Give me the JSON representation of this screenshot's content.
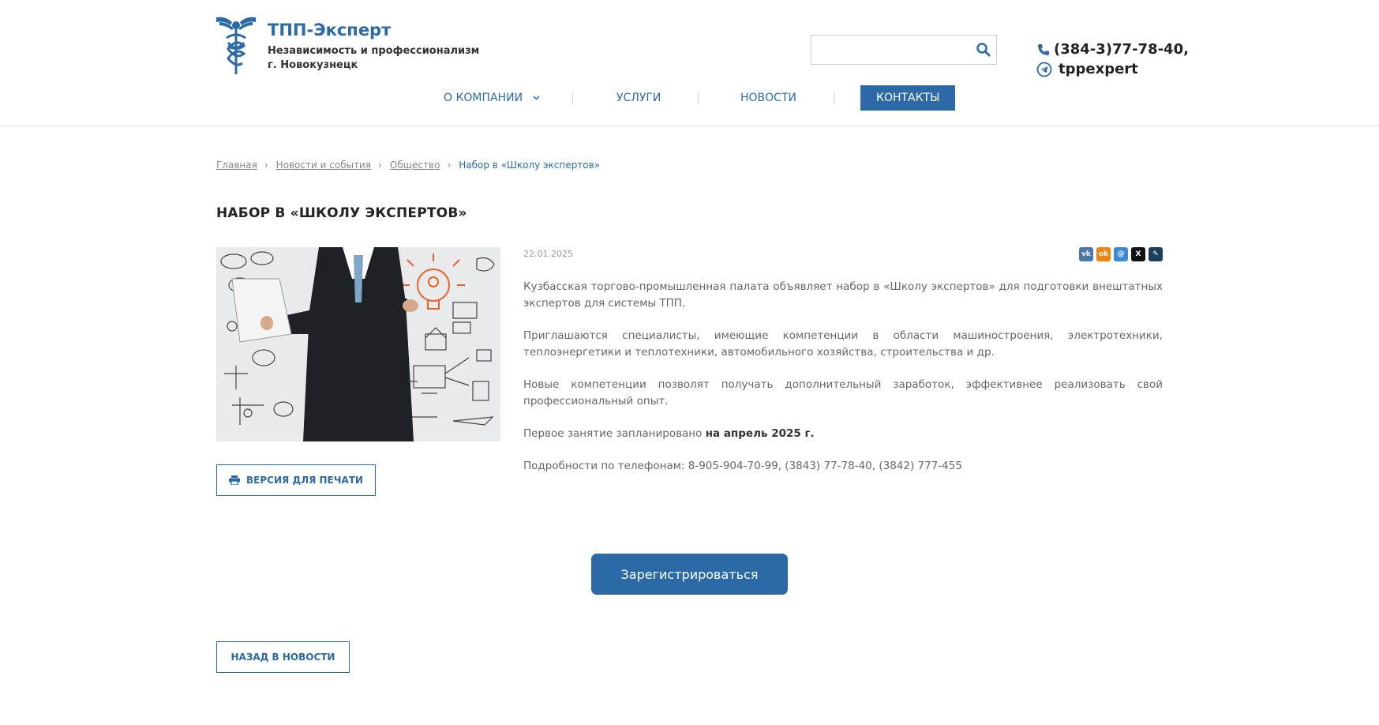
{
  "header": {
    "brand_title": "ТПП-Эксперт",
    "brand_sub_1": "Независимость и профессионализм",
    "brand_sub_2": "г. Новокузнецк",
    "search": {
      "placeholder": "",
      "value": ""
    },
    "phone": "(384-3)77-78-40,",
    "telegram": "tppexpert"
  },
  "nav": {
    "items": [
      {
        "label": "О компании",
        "has_dropdown": true
      },
      {
        "label": "Услуги"
      },
      {
        "label": "Новости"
      },
      {
        "label": "Контакты",
        "active": true
      }
    ]
  },
  "breadcrumb": {
    "items": [
      "Главная",
      "Новости и события",
      "Общество"
    ],
    "current": "Набор в «Школу экспертов»"
  },
  "page": {
    "title": "НАБОР В «ШКОЛУ ЭКСПЕРТОВ»",
    "date": "22.01.2025",
    "paragraphs": [
      "Кузбасская торгово-промышленная палата объявляет набор в «Школу экспертов» для подготовки внештатных экспертов для системы ТПП.",
      "Приглашаются специалисты, имеющие компетенции в области машиностроения, электротехники, теплоэнергетики и теплотехники, автомобильного хозяйства, строительства и др.",
      "Новые компетенции позволят получать дополнительный заработок, эффективнее реализовать свой профессиональный опыт."
    ],
    "p4_prefix": "Первое занятие запланировано ",
    "p4_bold": "на апрель 2025 г.",
    "p5": "Подробности по телефонам: 8-905-904-70-99, (3843) 77-78-40, (3842) 777-455"
  },
  "buttons": {
    "print": "ВЕРСИЯ ДЛЯ ПЕЧАТИ",
    "register": "Зарегистрироваться",
    "back": "НАЗАД В НОВОСТИ"
  },
  "share": {
    "icons": [
      "vk-icon",
      "odnoklassniki-icon",
      "moimir-icon",
      "x-icon",
      "livejournal-icon"
    ]
  },
  "colors": {
    "accent": "#2b6aa6"
  }
}
